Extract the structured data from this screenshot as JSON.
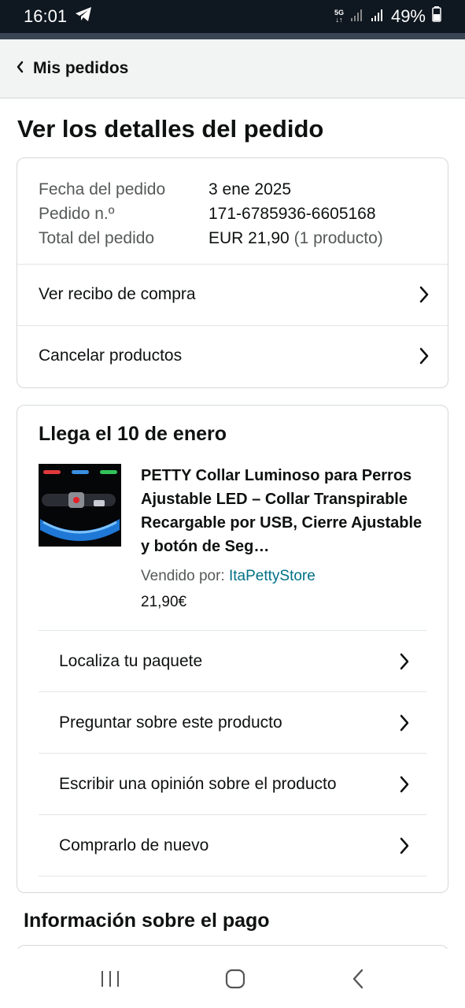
{
  "status_bar": {
    "time": "16:01",
    "network_label": "5G",
    "battery": "49%",
    "icons": [
      "telegram-icon",
      "signal-icon",
      "signal-icon",
      "battery-icon"
    ]
  },
  "header": {
    "back_label": "Mis pedidos"
  },
  "page_title": "Ver los detalles del pedido",
  "order_summary": {
    "rows": [
      {
        "label": "Fecha del pedido",
        "value": "3 ene 2025"
      },
      {
        "label": "Pedido n.º",
        "value": "171-6785936-6605168"
      },
      {
        "label": "Total del pedido",
        "value": "EUR 21,90",
        "extra": "(1 producto)"
      }
    ],
    "links": [
      {
        "label": "Ver recibo de compra"
      },
      {
        "label": "Cancelar productos"
      }
    ]
  },
  "shipment": {
    "arrival": "Llega el 10 de enero",
    "product": {
      "title": "PETTY Collar Luminoso para Perros Ajustable LED – Collar Transpirable Recargable por USB, Cierre Ajustable y botón de Seg…",
      "seller_label": "Vendido por:",
      "seller_name": "ItaPettyStore",
      "price": "21,90€"
    },
    "actions": [
      {
        "label": "Localiza tu paquete"
      },
      {
        "label": "Preguntar sobre este producto"
      },
      {
        "label": "Escribir una opinión sobre el producto"
      },
      {
        "label": "Comprarlo de nuevo"
      }
    ]
  },
  "payment": {
    "title": "Información sobre el pago"
  },
  "colors": {
    "link": "#007185",
    "text": "#0f1111",
    "muted": "#565959",
    "border": "#d5d9d9"
  }
}
